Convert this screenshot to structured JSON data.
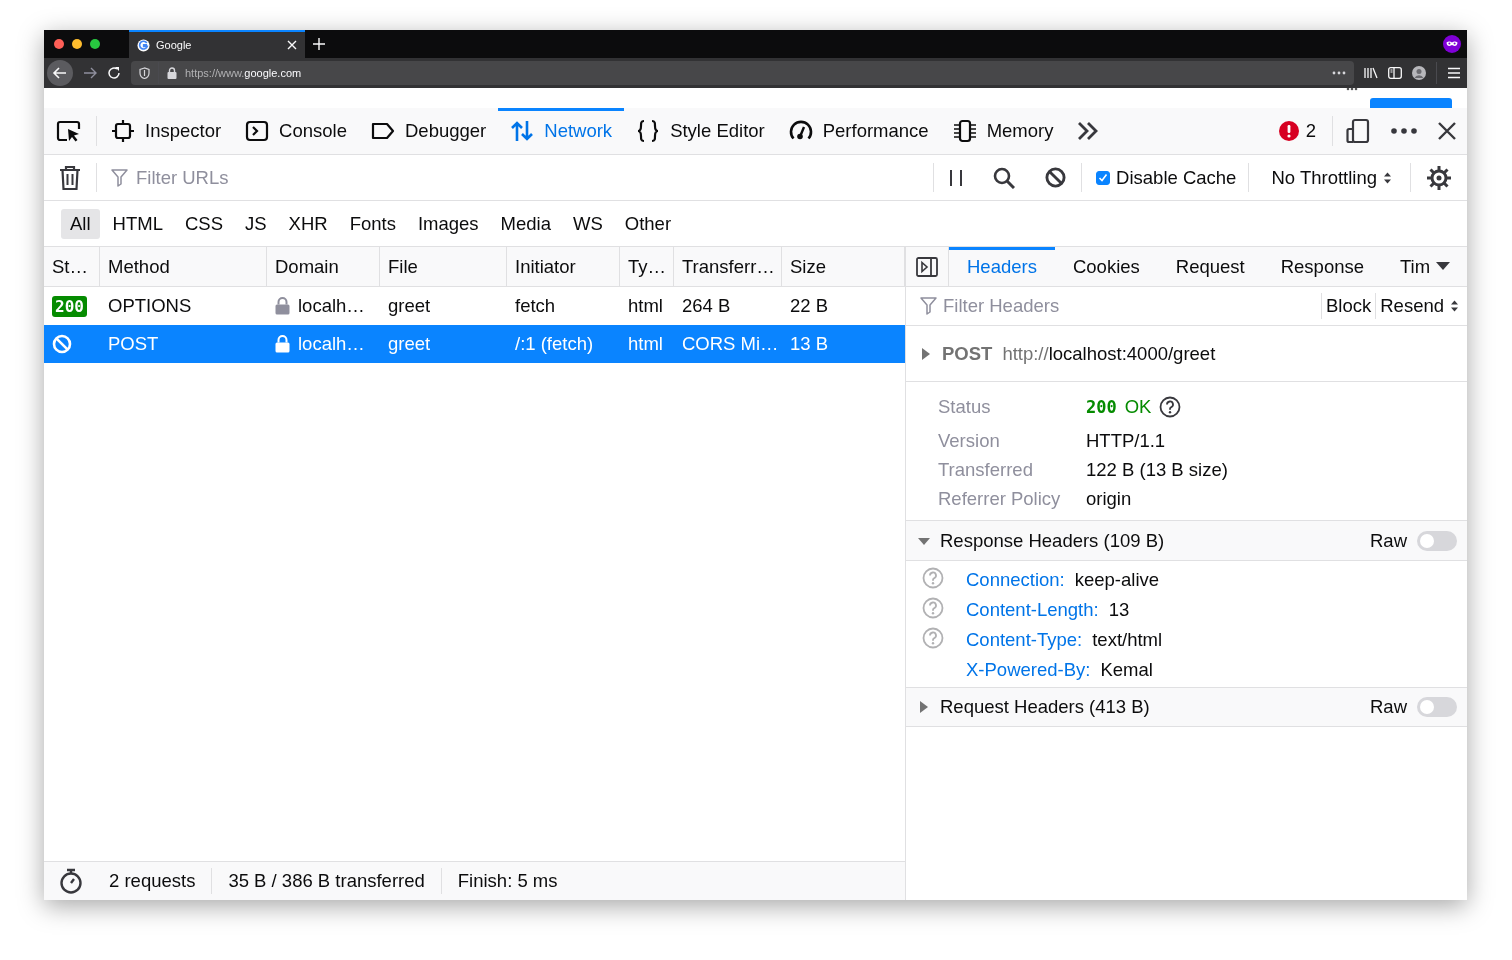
{
  "browser": {
    "tab": {
      "title": "Google",
      "selected": true
    },
    "url": {
      "prefix": "https://www.",
      "host": "google.com"
    }
  },
  "devtools": {
    "tools": [
      {
        "label": "Inspector",
        "selected": false
      },
      {
        "label": "Console",
        "selected": false
      },
      {
        "label": "Debugger",
        "selected": false
      },
      {
        "label": "Network",
        "selected": true
      },
      {
        "label": "Style Editor",
        "selected": false
      },
      {
        "label": "Performance",
        "selected": false
      },
      {
        "label": "Memory",
        "selected": false
      }
    ],
    "errors": {
      "count": "2"
    },
    "url_filter": {
      "placeholder": "Filter URLs"
    },
    "disable_cache": {
      "label": "Disable Cache",
      "checked": true
    },
    "throttling": {
      "value": "No Throttling"
    },
    "type_filters": [
      {
        "label": "All",
        "selected": true
      },
      {
        "label": "HTML",
        "selected": false
      },
      {
        "label": "CSS",
        "selected": false
      },
      {
        "label": "JS",
        "selected": false
      },
      {
        "label": "XHR",
        "selected": false
      },
      {
        "label": "Fonts",
        "selected": false
      },
      {
        "label": "Images",
        "selected": false
      },
      {
        "label": "Media",
        "selected": false
      },
      {
        "label": "WS",
        "selected": false
      },
      {
        "label": "Other",
        "selected": false
      }
    ],
    "columns": [
      "St…",
      "Method",
      "Domain",
      "File",
      "Initiator",
      "Ty…",
      "Transferr…",
      "Size"
    ],
    "requests": [
      {
        "status": "200",
        "blocked": false,
        "method": "OPTIONS",
        "domain": "localh…",
        "file": "greet",
        "initiator": "fetch",
        "type": "html",
        "transferred": "264 B",
        "size": "22 B",
        "selected": false
      },
      {
        "blocked": true,
        "method": "POST",
        "domain": "localh…",
        "file": "greet",
        "initiator": "/:1 (fetch)",
        "type": "html",
        "transferred": "CORS Mi…",
        "size": "13 B",
        "selected": true
      }
    ],
    "summary": {
      "requests": "2 requests",
      "transferred": "35 B / 386 B transferred",
      "finish": "Finish: 5 ms"
    },
    "details": {
      "tabs": [
        {
          "label": "Headers",
          "selected": true
        },
        {
          "label": "Cookies",
          "selected": false
        },
        {
          "label": "Request",
          "selected": false
        },
        {
          "label": "Response",
          "selected": false
        },
        {
          "label": "Tim",
          "selected": false
        }
      ],
      "filter": {
        "placeholder": "Filter Headers"
      },
      "buttons": [
        "Block",
        "Resend"
      ],
      "request_line": {
        "method": "POST",
        "scheme": "http://",
        "address": "localhost:4000/greet",
        "expanded": false
      },
      "fields": [
        {
          "kind": "status",
          "label": "Status",
          "code": "200",
          "text": "OK"
        },
        {
          "kind": "text",
          "label": "Version",
          "value": "HTTP/1.1"
        },
        {
          "kind": "text",
          "label": "Transferred",
          "value": "122 B (13 B size)"
        },
        {
          "kind": "text",
          "label": "Referrer Policy",
          "value": "origin"
        }
      ],
      "sections": [
        {
          "title": "Response Headers (109 B)",
          "expanded": true,
          "raw_label": "Raw",
          "raw": false,
          "headers": [
            {
              "name": "Connection:",
              "value": "keep-alive",
              "help": true
            },
            {
              "name": "Content-Length:",
              "value": "13",
              "help": true
            },
            {
              "name": "Content-Type:",
              "value": "text/html",
              "help": true
            },
            {
              "name": "X-Powered-By:",
              "value": "Kemal",
              "help": false
            }
          ]
        },
        {
          "title": "Request Headers (413 B)",
          "expanded": false,
          "raw_label": "Raw",
          "raw": false
        }
      ]
    }
  }
}
